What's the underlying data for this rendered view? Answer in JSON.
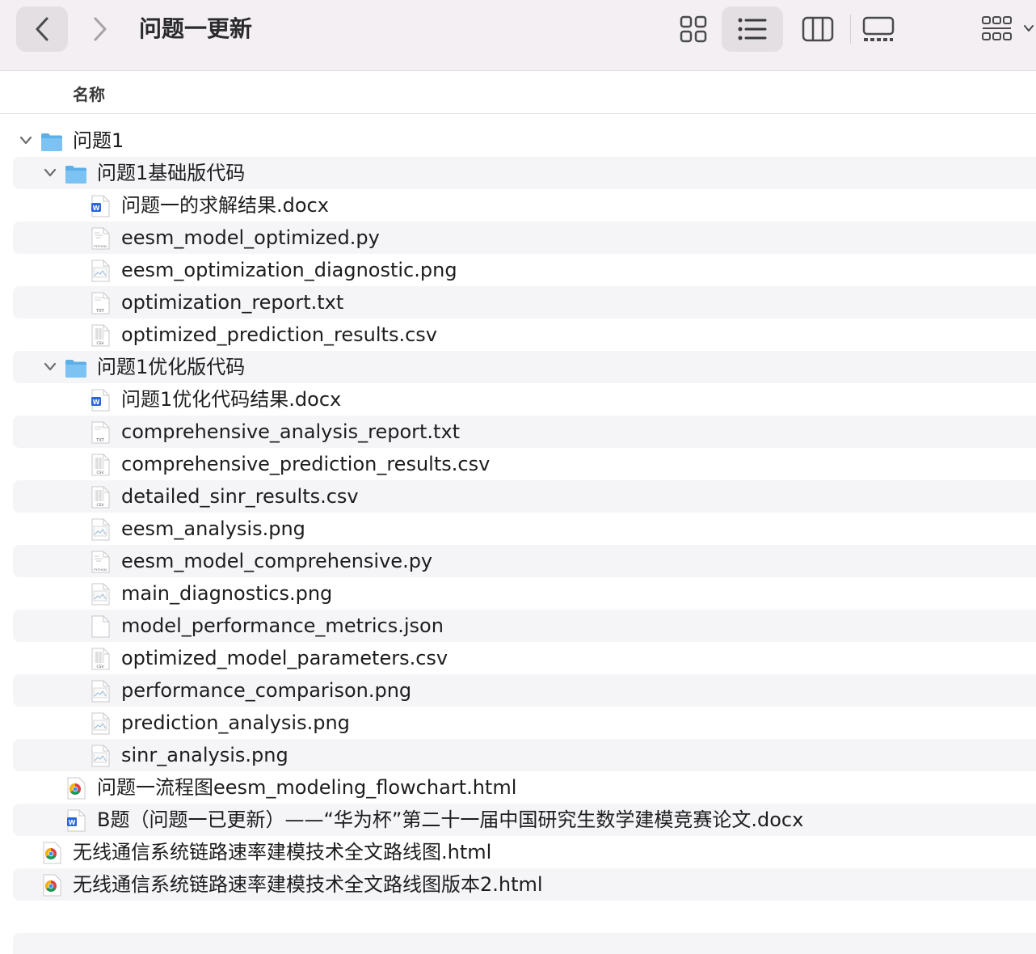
{
  "window": {
    "title": "问题一更新"
  },
  "header": {
    "name_column": "名称"
  },
  "colors": {
    "folder": "#5eaee8",
    "word": "#2b65d9",
    "chrome_red": "#db4437",
    "chrome_yellow": "#f4b400",
    "chrome_green": "#0f9d58",
    "chrome_blue": "#4285f4"
  },
  "files": [
    {
      "name": "问题1",
      "type": "folder",
      "depth": 0,
      "expanded": true
    },
    {
      "name": "问题1基础版代码",
      "type": "folder",
      "depth": 1,
      "expanded": true
    },
    {
      "name": "问题一的求解结果.docx",
      "type": "docx",
      "depth": 2
    },
    {
      "name": "eesm_model_optimized.py",
      "type": "py",
      "depth": 2
    },
    {
      "name": "eesm_optimization_diagnostic.png",
      "type": "png",
      "depth": 2
    },
    {
      "name": "optimization_report.txt",
      "type": "txt",
      "depth": 2
    },
    {
      "name": "optimized_prediction_results.csv",
      "type": "csv",
      "depth": 2
    },
    {
      "name": "问题1优化版代码",
      "type": "folder",
      "depth": 1,
      "expanded": true
    },
    {
      "name": "问题1优化代码结果.docx",
      "type": "docx",
      "depth": 2
    },
    {
      "name": "comprehensive_analysis_report.txt",
      "type": "txt",
      "depth": 2
    },
    {
      "name": "comprehensive_prediction_results.csv",
      "type": "csv",
      "depth": 2
    },
    {
      "name": "detailed_sinr_results.csv",
      "type": "csv",
      "depth": 2
    },
    {
      "name": "eesm_analysis.png",
      "type": "png",
      "depth": 2
    },
    {
      "name": "eesm_model_comprehensive.py",
      "type": "py",
      "depth": 2
    },
    {
      "name": "main_diagnostics.png",
      "type": "png",
      "depth": 2
    },
    {
      "name": "model_performance_metrics.json",
      "type": "json",
      "depth": 2
    },
    {
      "name": "optimized_model_parameters.csv",
      "type": "csv",
      "depth": 2
    },
    {
      "name": "performance_comparison.png",
      "type": "png",
      "depth": 2
    },
    {
      "name": "prediction_analysis.png",
      "type": "png",
      "depth": 2
    },
    {
      "name": "sinr_analysis.png",
      "type": "png",
      "depth": 2
    },
    {
      "name": "问题一流程图eesm_modeling_flowchart.html",
      "type": "html",
      "depth": 1
    },
    {
      "name": "B题（问题一已更新）——“华为杯”第二十一届中国研究生数学建模竞赛论文.docx",
      "type": "docx",
      "depth": 1
    },
    {
      "name": "无线通信系统链路速率建模技术全文路线图.html",
      "type": "html",
      "depth": 0
    },
    {
      "name": "无线通信系统链路速率建模技术全文路线图版本2.html",
      "type": "html",
      "depth": 0
    }
  ]
}
